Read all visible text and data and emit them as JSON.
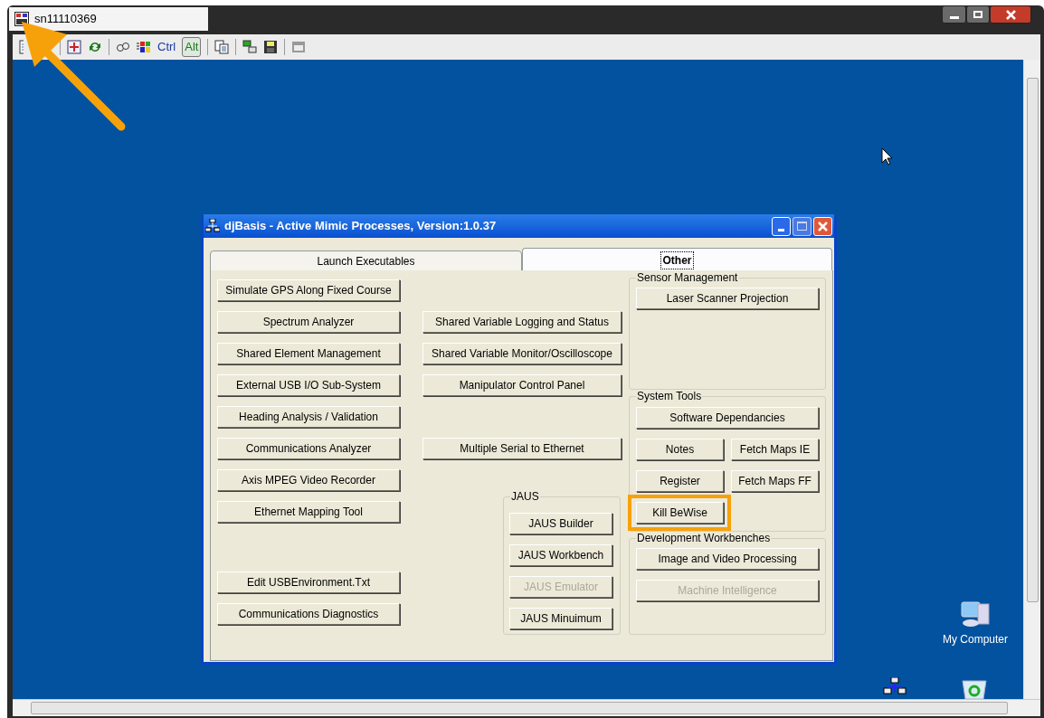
{
  "vnc_window": {
    "title": "sn11110369"
  },
  "toolbar": {
    "ctrl_label": "Ctrl",
    "alt_button": {
      "label": "Alt",
      "pressed": true
    }
  },
  "dialog": {
    "title": "djBasis - Active Mimic Processes, Version:1.0.37",
    "tabs": [
      {
        "label": "Launch Executables",
        "selected": false
      },
      {
        "label": "Other",
        "selected": true
      }
    ],
    "left_buttons": [
      {
        "label": "Simulate GPS Along Fixed Course",
        "disabled": false
      },
      {
        "label": "Spectrum Analyzer",
        "disabled": false
      },
      {
        "label": "Shared Element Management",
        "disabled": false
      },
      {
        "label": "External USB I/O Sub-System",
        "disabled": false
      },
      {
        "label": "Heading Analysis / Validation",
        "disabled": false
      },
      {
        "label": "Communications Analyzer",
        "disabled": false
      },
      {
        "label": "Axis MPEG Video Recorder",
        "disabled": false
      },
      {
        "label": "Ethernet Mapping Tool",
        "disabled": false
      },
      {
        "label": "Edit USBEnvironment.Txt",
        "disabled": false
      },
      {
        "label": "Communications Diagnostics",
        "disabled": false
      }
    ],
    "middle_buttons": [
      {
        "label": "Shared Variable Logging and Status",
        "disabled": false
      },
      {
        "label": "Shared Variable Monitor/Oscilloscope",
        "disabled": false
      },
      {
        "label": "Manipulator Control Panel",
        "disabled": false
      },
      {
        "label": "Multiple Serial to Ethernet",
        "disabled": false
      }
    ],
    "groups": [
      {
        "title": "JAUS",
        "buttons": [
          {
            "label": "JAUS Builder",
            "kind": "full",
            "disabled": false,
            "highlighted": false
          },
          {
            "label": "JAUS Workbench",
            "kind": "full",
            "disabled": false,
            "highlighted": false
          },
          {
            "label": "JAUS Emulator",
            "kind": "full",
            "disabled": true,
            "highlighted": false
          },
          {
            "label": "JAUS Minuimum",
            "kind": "full",
            "disabled": false,
            "highlighted": false
          }
        ]
      },
      {
        "title": "Sensor Management",
        "buttons": [
          {
            "label": "Laser Scanner Projection",
            "kind": "full",
            "disabled": false,
            "highlighted": false
          }
        ]
      },
      {
        "title": "System Tools",
        "buttons": [
          {
            "label": "Software Dependancies",
            "kind": "full",
            "disabled": false,
            "highlighted": false
          },
          {
            "label": "Notes",
            "kind": "half",
            "disabled": false,
            "highlighted": false
          },
          {
            "label": "Fetch Maps IE",
            "kind": "half",
            "disabled": false,
            "highlighted": false
          },
          {
            "label": "Register",
            "kind": "half",
            "disabled": false,
            "highlighted": false
          },
          {
            "label": "Fetch Maps FF",
            "kind": "half",
            "disabled": false,
            "highlighted": false
          },
          {
            "label": "Kill BeWise",
            "kind": "half",
            "disabled": false,
            "highlighted": true
          }
        ]
      },
      {
        "title": "Development Workbenches",
        "buttons": [
          {
            "label": "Image and Video Processing",
            "kind": "full",
            "disabled": false,
            "highlighted": false
          },
          {
            "label": "Machine Intelligence",
            "kind": "full",
            "disabled": true,
            "highlighted": false
          }
        ]
      }
    ]
  },
  "desktop_icons": [
    {
      "label": "My Computer"
    }
  ],
  "annotation": {
    "pointer_arrow": true
  }
}
